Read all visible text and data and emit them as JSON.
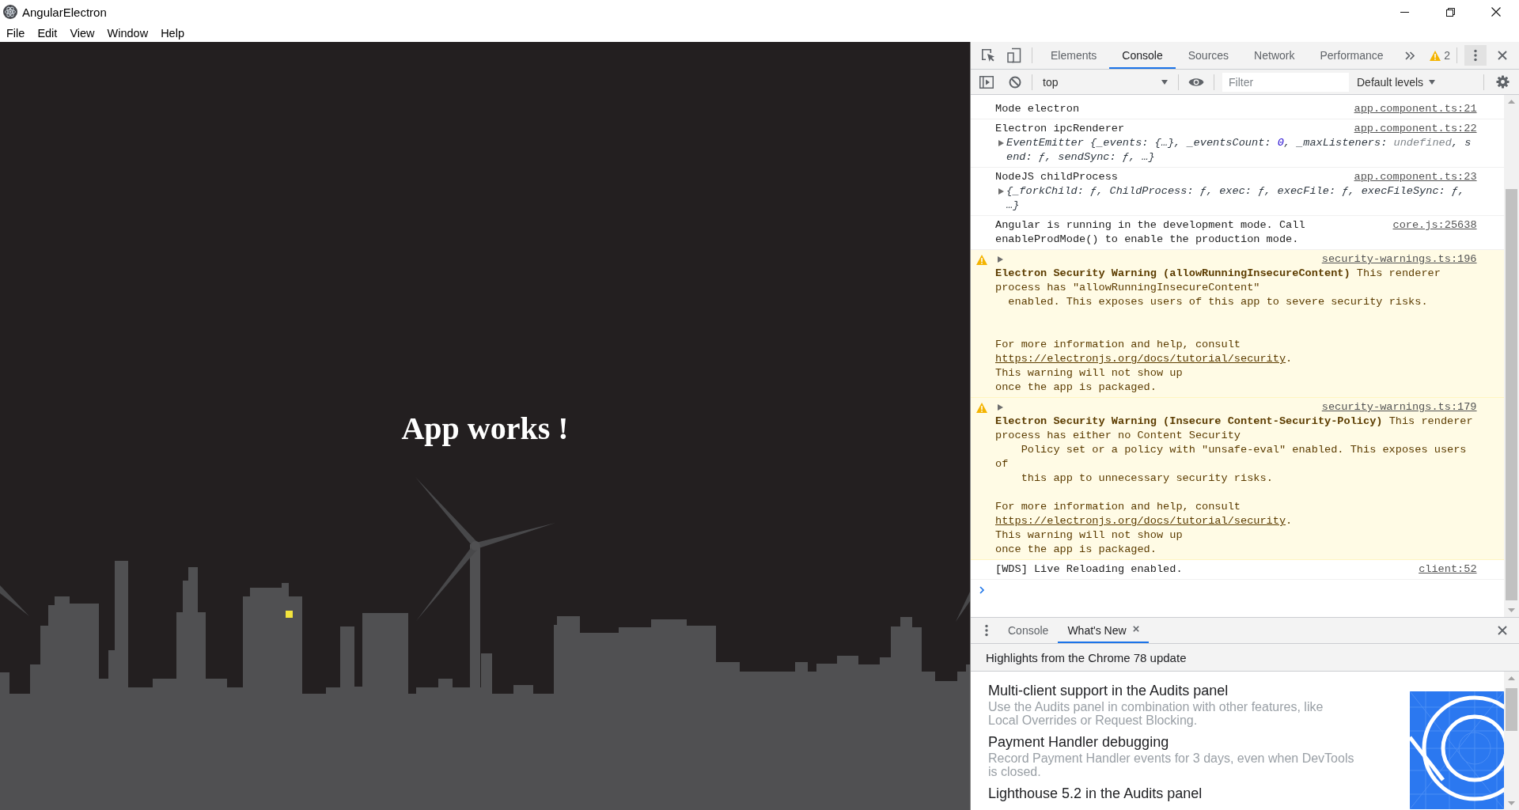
{
  "window": {
    "title": "AngularElectron"
  },
  "menu": [
    "File",
    "Edit",
    "View",
    "Window",
    "Help"
  ],
  "app": {
    "heading": "App works !"
  },
  "devtools": {
    "tabs": [
      {
        "label": "Elements",
        "selected": false
      },
      {
        "label": "Console",
        "selected": true
      },
      {
        "label": "Sources",
        "selected": false
      },
      {
        "label": "Network",
        "selected": false
      },
      {
        "label": "Performance",
        "selected": false
      }
    ],
    "warning_count": "2",
    "console_toolbar": {
      "context": "top",
      "filter": {
        "placeholder": "Filter"
      },
      "levels": "Default levels"
    },
    "messages": [
      {
        "kind": "log",
        "text": "Mode electron",
        "source": "app.component.ts:21"
      },
      {
        "kind": "log",
        "text": "Electron ipcRenderer",
        "source": "app.component.ts:22",
        "expanded": false,
        "preview": [
          {
            "text": "EventEmitter {_events: {…}, _eventsCount: ",
            "kind": "plain"
          },
          {
            "text": "0",
            "kind": "number"
          },
          {
            "text": ", _maxListeners: ",
            "kind": "plain"
          },
          {
            "text": "undefined",
            "kind": "undefined"
          },
          {
            "text": ", send: ƒ, sendSync: ƒ, …}",
            "kind": "plain"
          }
        ]
      },
      {
        "kind": "log",
        "text": "NodeJS childProcess",
        "source": "app.component.ts:23",
        "expanded": false,
        "preview": [
          {
            "text": "{_forkChild: ƒ, ChildProcess: ƒ, exec: ƒ, execFile: ƒ, execFileSync: ƒ, …}",
            "kind": "plain"
          }
        ]
      },
      {
        "kind": "log",
        "text": "Angular is running in the development mode. Call enableProdMode() to enable the production mode.",
        "source": "core.js:25638"
      },
      {
        "kind": "warning",
        "source": "security-warnings.ts:196",
        "expanded": false,
        "text": "**Electron Security Warning (allowRunningInsecureContent)** This renderer process has \"allowRunningInsecureContent\"\n  enabled. This exposes users of this app to severe security risks.\n\n\nFor more information and help, consult\n",
        "link": "https://electronjs.org/docs/tutorial/security",
        "text_after": ".\nThis warning will not show up\nonce the app is packaged."
      },
      {
        "kind": "warning",
        "source": "security-warnings.ts:179",
        "expanded": false,
        "text": "**Electron Security Warning (Insecure Content-Security-Policy)** This renderer process has either no Content Security\n    Policy set or a policy with \"unsafe-eval\" enabled. This exposes users of\n    this app to unnecessary security risks.\n\nFor more information and help, consult\n",
        "link": "https://electronjs.org/docs/tutorial/security",
        "text_after": ".\nThis warning will not show up\nonce the app is packaged."
      },
      {
        "kind": "log",
        "text": "[WDS] Live Reloading enabled.",
        "source": "client:52"
      }
    ]
  },
  "drawer": {
    "tabs": [
      {
        "label": "Console",
        "selected": false,
        "closable": false
      },
      {
        "label": "What's New",
        "selected": true,
        "closable": true
      }
    ],
    "header": "Highlights from the Chrome 78 update",
    "items": [
      {
        "title": "Multi-client support in the Audits panel",
        "description": "Use the Audits panel in combination with other features, like Local Overrides or Request Blocking."
      },
      {
        "title": "Payment Handler debugging",
        "description": "Record Payment Handler events for 3 days, even when DevTools is closed."
      },
      {
        "title": "Lighthouse 5.2 in the Audits panel"
      }
    ]
  }
}
